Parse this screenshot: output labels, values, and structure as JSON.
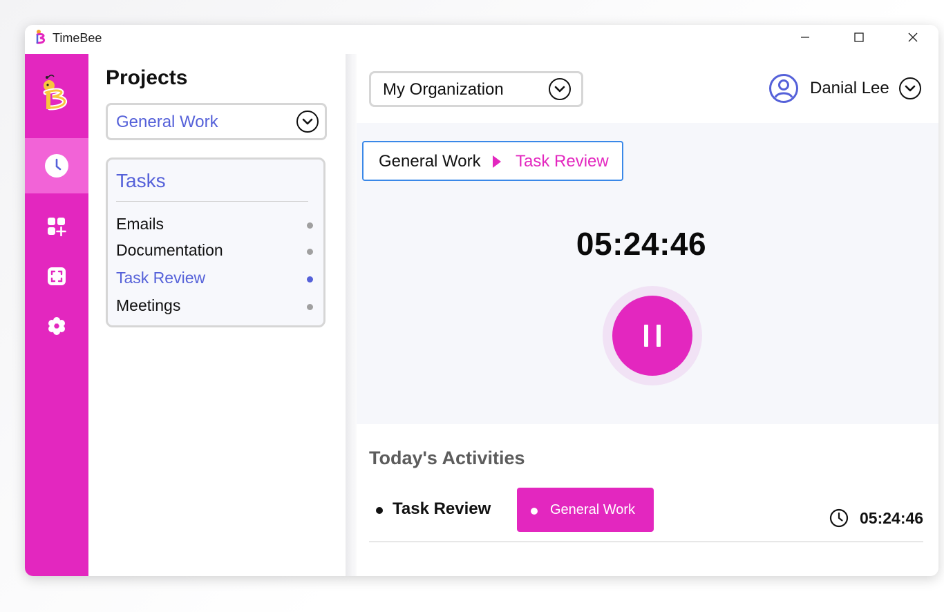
{
  "app": {
    "title": "TimeBee"
  },
  "colors": {
    "brand": "#e327bf",
    "accent": "#5561d9",
    "breadcrumb_border": "#3a88e8"
  },
  "window_controls": {
    "minimize": "minimize-icon",
    "maximize": "maximize-icon",
    "close": "close-icon"
  },
  "rail": {
    "items": [
      {
        "icon": "clock-icon",
        "active": true
      },
      {
        "icon": "apps-add-icon",
        "active": false
      },
      {
        "icon": "screenshot-icon",
        "active": false
      },
      {
        "icon": "gear-icon",
        "active": false
      }
    ]
  },
  "projects": {
    "title": "Projects",
    "selected_project": "General Work",
    "tasks_title": "Tasks",
    "tasks": [
      {
        "label": "Emails",
        "active": false
      },
      {
        "label": "Documentation",
        "active": false
      },
      {
        "label": "Task Review",
        "active": true
      },
      {
        "label": "Meetings",
        "active": false
      }
    ]
  },
  "header": {
    "organization": "My Organization",
    "user_name": "Danial Lee"
  },
  "timer": {
    "breadcrumb_project": "General Work",
    "breadcrumb_task": "Task Review",
    "elapsed": "05:24:46",
    "state": "running"
  },
  "activities": {
    "title": "Today's Activities",
    "items": [
      {
        "task": "Task Review",
        "project": "General Work",
        "duration": "05:24:46"
      }
    ]
  }
}
